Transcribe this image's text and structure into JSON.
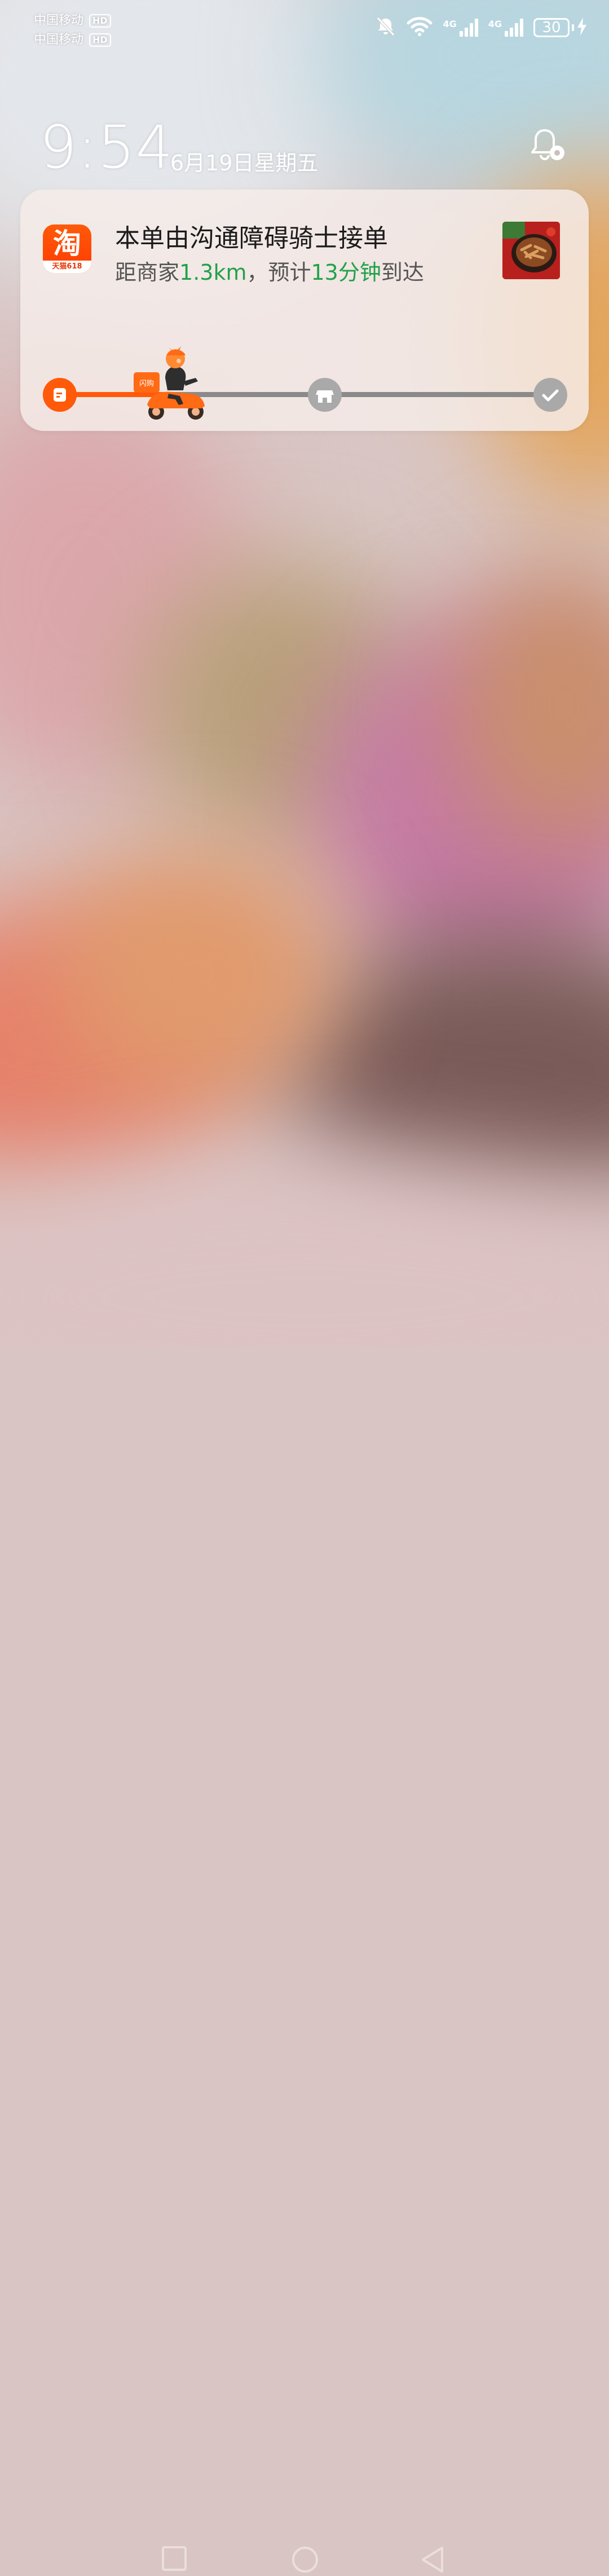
{
  "status_bar": {
    "carrier_1": "中国移动",
    "carrier_2": "中国移动",
    "hd_label": "HD",
    "network_1": "4G",
    "network_2": "4G",
    "battery_level": "30"
  },
  "lock_screen": {
    "time": "9:54",
    "date": "6月19日星期五"
  },
  "notification": {
    "app_icon_glyph": "淘",
    "app_icon_caption": "天猫618",
    "title": "本单由沟通障碍骑士接单",
    "subtitle": {
      "prefix": "距商家",
      "distance": "1.3km",
      "middle": "，预计",
      "eta": "13分钟",
      "suffix": "到达"
    },
    "rider_box_label": "闪购",
    "progress_fraction": 0.22
  },
  "colors": {
    "accent": "#ff5a0a",
    "highlight_green": "#22a14a",
    "track_gray": "#8a8a8a",
    "node_gray": "#a9a9a9"
  },
  "icons": {
    "muted_bell": "bell-off-icon",
    "wifi": "wifi-icon",
    "charging": "lightning-icon",
    "settings": "bell-settings-icon",
    "start": "order-icon",
    "store": "store-icon",
    "done": "check-icon",
    "nav_recent": "square-icon",
    "nav_home": "circle-icon",
    "nav_back": "triangle-back-icon"
  }
}
